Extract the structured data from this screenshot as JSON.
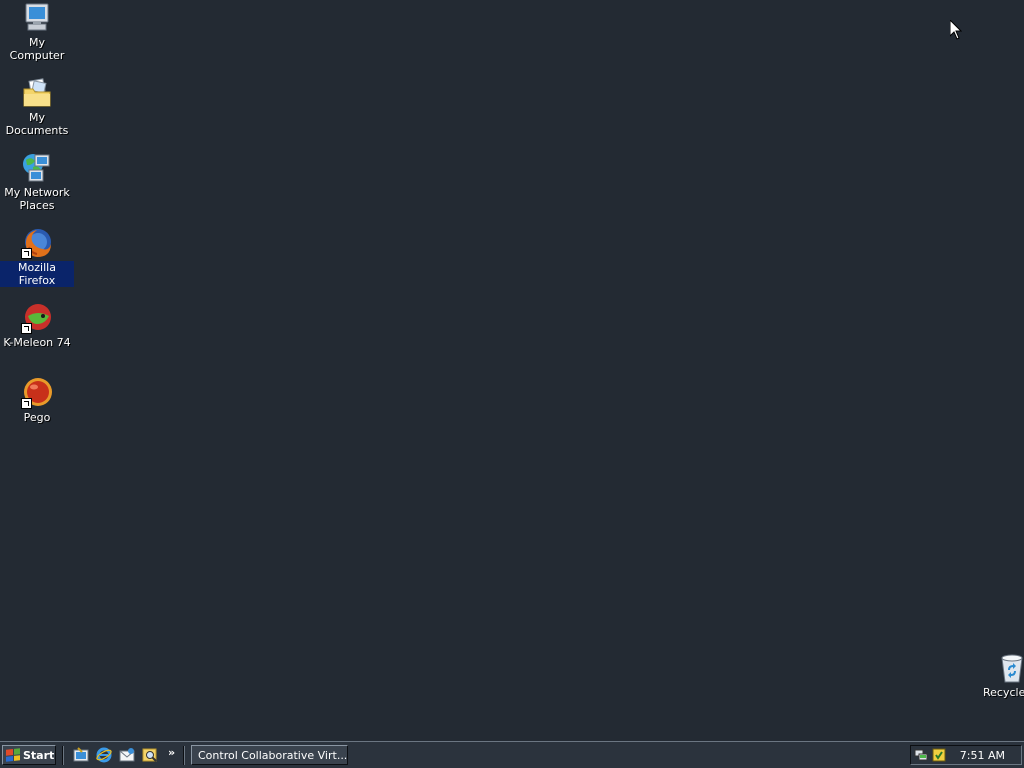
{
  "desktop": {
    "icons": [
      {
        "label": "My Computer",
        "icon": "computer-icon"
      },
      {
        "label": "My Documents",
        "icon": "documents-folder-icon"
      },
      {
        "label": "My Network\nPlaces",
        "icon": "network-places-icon"
      },
      {
        "label": "Mozilla Firefox",
        "icon": "firefox-icon",
        "selected": true
      },
      {
        "label": "K-Meleon 74",
        "icon": "k-meleon-icon"
      },
      {
        "label": "Pego",
        "icon": "pego-icon"
      },
      {
        "label": "Recycle",
        "icon": "recycle-bin-icon"
      }
    ]
  },
  "taskbar": {
    "start_label": "Start",
    "quick_launch": [
      "show-desktop-icon",
      "internet-explorer-icon",
      "outlook-express-icon",
      "search-icon"
    ],
    "chevron": "»",
    "task_button_label": "Control Collaborative Virt...",
    "tray_icons": [
      "network-icon",
      "security-icon"
    ],
    "clock": "7:51 AM"
  },
  "colors": {
    "desktop_bg": "#232a33",
    "selection": "#0a246a"
  }
}
